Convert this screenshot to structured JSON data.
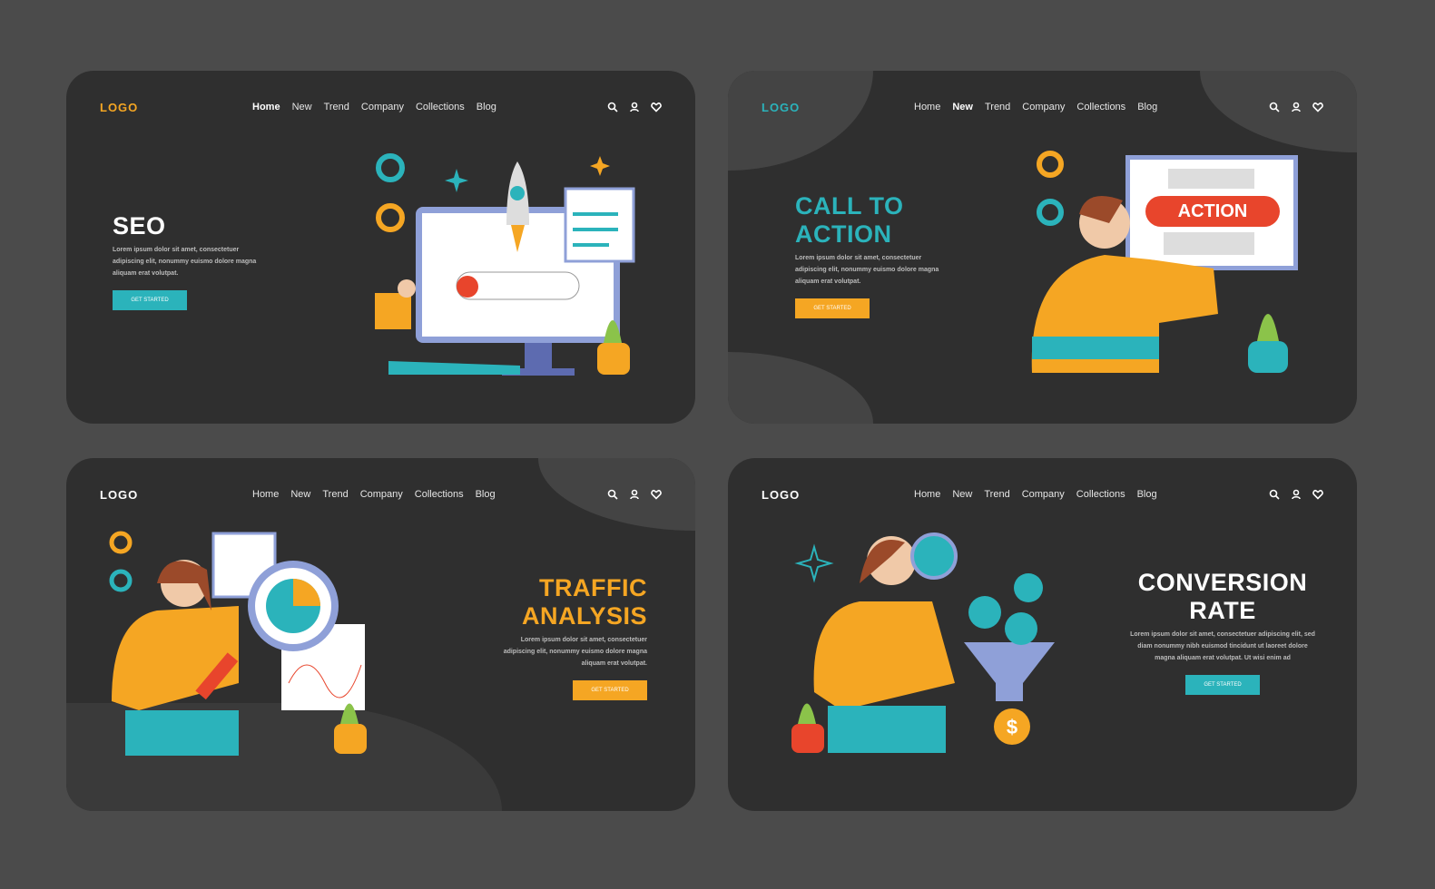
{
  "colors": {
    "background": "#4b4b4b",
    "card": "#2f2f2f",
    "teal": "#2bb3bb",
    "orange": "#f5a623",
    "red": "#e8452c",
    "white": "#ffffff"
  },
  "nav_links": [
    "Home",
    "New",
    "Trend",
    "Company",
    "Collections",
    "Blog"
  ],
  "nav_icons": [
    "search-icon",
    "user-icon",
    "heart-icon"
  ],
  "cards": [
    {
      "logo": "LOGO",
      "active": "Home",
      "title": "SEO",
      "body": "Lorem ipsum dolor sit amet, consectetuer adipiscing elit, nonummy euismo dolore magna aliquam erat volutpat.",
      "button": "GET STARTED"
    },
    {
      "logo": "LOGO",
      "active": "New",
      "title": "CALL TO ACTION",
      "body": "Lorem ipsum dolor sit amet, consectetuer adipiscing elit, nonummy euismo dolore magna aliquam erat volutpat.",
      "button": "GET STARTED",
      "screen_button": "ACTION"
    },
    {
      "logo": "LOGO",
      "active": "",
      "title": "TRAFFIC ANALYSIS",
      "body": "Lorem ipsum dolor sit amet, consectetuer adipiscing elit, nonummy euismo dolore magna aliquam erat volutpat.",
      "button": "GET STARTED"
    },
    {
      "logo": "LOGO",
      "active": "",
      "title": "CONVERSION RATE",
      "body": "Lorem ipsum dolor sit amet, consectetuer adipiscing elit, sed diam nonummy nibh euismod tincidunt ut laoreet dolore magna aliquam erat volutpat. Ut wisi enim ad",
      "button": "GET STARTED",
      "dollar": "$"
    }
  ]
}
